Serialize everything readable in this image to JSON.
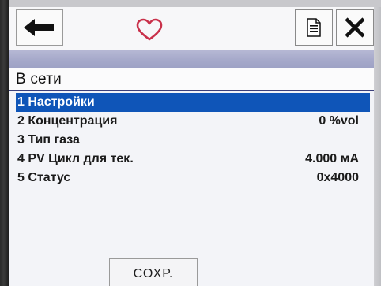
{
  "toolbar": {
    "back_icon": "arrow-left-icon",
    "favorite_icon": "heart-icon",
    "document_icon": "document-icon",
    "close_icon": "close-x-icon"
  },
  "status": {
    "text": "В сети"
  },
  "menu": {
    "items": [
      {
        "label": "1 Настройки",
        "value": ""
      },
      {
        "label": "2 Концентрация",
        "value": "0 %vol"
      },
      {
        "label": "3 Тип газа",
        "value": ""
      },
      {
        "label": "4 PV Цикл для тек.",
        "value": "4.000 мА"
      },
      {
        "label": "5 Статус",
        "value": "0x4000"
      }
    ]
  },
  "footer": {
    "save_label": "СОХР."
  },
  "colors": {
    "selection": "#0f55b8",
    "heart": "#c9304a",
    "header_band": "#a7aacb"
  }
}
